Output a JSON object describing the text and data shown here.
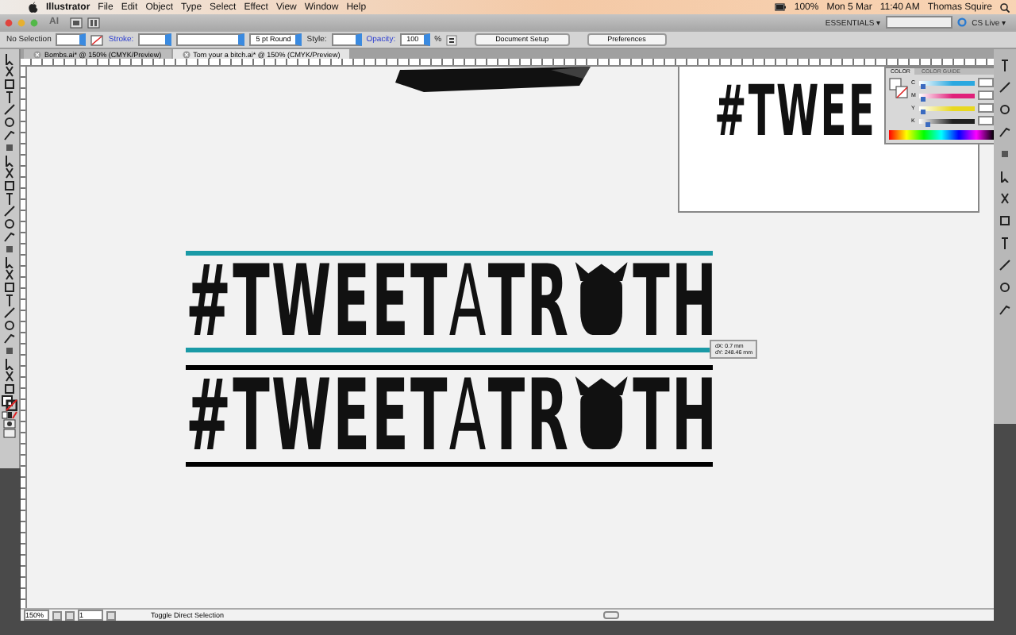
{
  "menu_bar": {
    "items": [
      "Illustrator",
      "File",
      "Edit",
      "Object",
      "Type",
      "Select",
      "Effect",
      "View",
      "Window",
      "Help"
    ],
    "status": [
      "100%",
      "Mon 5 Mar",
      "11:40 AM",
      "Thomas Squire"
    ]
  },
  "app_bar": {
    "logo": "AI",
    "workspace": "ESSENTIALS ▾",
    "live": "CS Live ▾"
  },
  "control_bar": {
    "selection": "No Selection",
    "stroke_label": "Stroke:",
    "brush": "5 pt Round",
    "style_label": "Style:",
    "opacity_label": "Opacity:",
    "opacity": "100",
    "percent": "%",
    "buttons": [
      "Document Setup",
      "Preferences"
    ]
  },
  "tabs": [
    {
      "label": "Bombs.ai* @ 150% (CMYK/Preview)",
      "selected": false
    },
    {
      "label": "Tom your a bitch.ai* @ 150% (CMYK/Preview)",
      "selected": true
    }
  ],
  "artwork": {
    "lines": [
      {
        "color": "#1a9aa6",
        "parts": [
          {
            "kind": "bold",
            "text": "#TWEET"
          },
          {
            "kind": "thin",
            "text": "A"
          },
          {
            "kind": "bold",
            "text": "TR"
          },
          {
            "kind": "bomb"
          },
          {
            "kind": "bold",
            "text": "TH"
          }
        ]
      },
      {
        "color": "#000000",
        "parts": [
          {
            "kind": "bold",
            "text": "#TWEET"
          },
          {
            "kind": "thin",
            "text": "A"
          },
          {
            "kind": "bold",
            "text": "TR"
          },
          {
            "kind": "bomb"
          },
          {
            "kind": "bold",
            "text": "TH"
          }
        ]
      }
    ],
    "tooltip": [
      "dX: 0.7 mm",
      "dY: 248.46 mm"
    ]
  },
  "second_window": {
    "text": "#TWEE"
  },
  "color_panel": {
    "tabs": [
      {
        "label": "COLOR",
        "selected": true
      },
      {
        "label": "COLOR GUIDE",
        "selected": false
      }
    ],
    "channels": [
      {
        "name": "C",
        "color": "#2aa8e0",
        "level": 0.05
      },
      {
        "name": "M",
        "color": "#e0207a",
        "level": 0.05
      },
      {
        "name": "Y",
        "color": "#e8d820",
        "level": 0.05
      },
      {
        "name": "K",
        "color": "#202020",
        "level": 0.15
      }
    ]
  },
  "status_bar": {
    "zoom": "150%",
    "page": "1",
    "tool": "Toggle Direct Selection"
  }
}
